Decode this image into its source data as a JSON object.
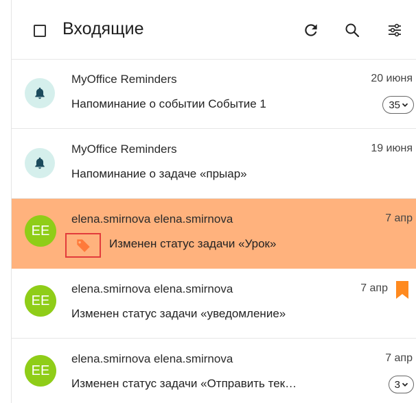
{
  "header": {
    "title": "Входящие",
    "icons": [
      "refresh-icon",
      "search-icon",
      "filter-settings-icon"
    ]
  },
  "messages": [
    {
      "sender": "MyOffice Reminders",
      "subject": "Напоминание о событии Событие 1",
      "date": "20 июня",
      "count": "35",
      "avatar_type": "bell-icon"
    },
    {
      "sender": "MyOffice Reminders",
      "subject": "Напоминание о задаче «прыар»",
      "date": "19 июня",
      "avatar_type": "bell-icon"
    },
    {
      "sender": "elena.smirnova elena.smirnova",
      "subject": "Изменен статус задачи «Урок»",
      "date": "7 апр",
      "avatar": "EE",
      "selected": true,
      "tag_icon": "tag-icon"
    },
    {
      "sender": "elena.smirnova elena.smirnova",
      "subject": "Изменен статус задачи «уведомление»",
      "date": "7 апр",
      "avatar": "EE",
      "flag_icon": "bookmark-icon"
    },
    {
      "sender": "elena.smirnova elena.smirnova",
      "subject": "Изменен статус задачи «Отправить тек…",
      "date": "7 апр",
      "avatar": "EE",
      "count": "3"
    }
  ],
  "colors": {
    "selected_row": "#ffb27d",
    "avatar_ee": "#8fcd18",
    "avatar_bell_bg": "#d5efec",
    "bell_icon": "#1b4a5c",
    "bookmark": "#ff8a1f",
    "tag": "#ff7a3a",
    "highlight_box": "#e23b3b"
  }
}
